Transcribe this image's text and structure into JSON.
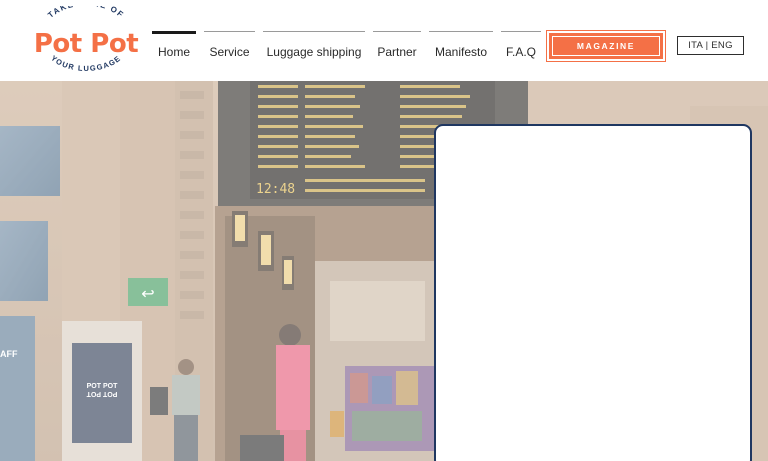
{
  "header": {
    "logo": {
      "top_text": "TAKE CARE OF",
      "wordmark": "Pot Pot",
      "bottom_text": "YOUR LUGGAGE",
      "color": "#f47046"
    },
    "nav": [
      {
        "label": "Home",
        "active": true
      },
      {
        "label": "Service",
        "active": false
      },
      {
        "label": "Luggage shipping",
        "active": false
      },
      {
        "label": "Partner",
        "active": false
      },
      {
        "label": "Manifesto",
        "active": false
      },
      {
        "label": "F.A.Q",
        "active": false
      }
    ],
    "magazine_label": "MAGAZINE",
    "lang_label": "ITA | ENG"
  },
  "hero": {
    "board_clock": "12:48",
    "exit_sign_glyph": "↩",
    "kiosk_text": "POT POT",
    "kiosk_text_mirror": "POT POT",
    "side_text": "AFF"
  },
  "colors": {
    "accent": "#f47046",
    "panel_border": "#1f3761",
    "board_led": "#e0b84a"
  }
}
